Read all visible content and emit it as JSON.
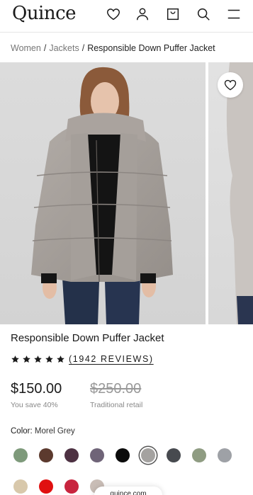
{
  "header": {
    "logo": "Quince",
    "icons": [
      "heart-icon",
      "user-icon",
      "bag-icon",
      "search-icon",
      "menu-icon"
    ]
  },
  "breadcrumb": {
    "items": [
      "Women",
      "Jackets"
    ],
    "current": "Responsible Down Puffer Jacket"
  },
  "product": {
    "title": "Responsible Down Puffer Jacket",
    "rating_stars": 5,
    "reviews_label": "(1942 REVIEWS)",
    "price": "$150.00",
    "savings": "You save 40%",
    "retail_price": "$250.00",
    "retail_label": "Traditional retail",
    "color_label": "Color:",
    "color_value": "Morel Grey"
  },
  "swatches": [
    {
      "name": "sage",
      "color": "#7e9a7b"
    },
    {
      "name": "brown",
      "color": "#5c3a2e"
    },
    {
      "name": "plum",
      "color": "#4d3142"
    },
    {
      "name": "dusty-purple",
      "color": "#6f6478"
    },
    {
      "name": "black",
      "color": "#0b0b0b"
    },
    {
      "name": "morel-grey",
      "color": "#a4a2a0",
      "selected": true
    },
    {
      "name": "charcoal",
      "color": "#474a4f"
    },
    {
      "name": "moss",
      "color": "#8f9c82"
    },
    {
      "name": "light-grey",
      "color": "#9ea1a6"
    },
    {
      "name": "cream",
      "color": "#d8c8ab"
    },
    {
      "name": "red",
      "color": "#e01010"
    },
    {
      "name": "raspberry",
      "color": "#c8243e"
    },
    {
      "name": "taupe",
      "color": "#c9bdb6"
    }
  ],
  "browser": {
    "url": "quince.com"
  }
}
